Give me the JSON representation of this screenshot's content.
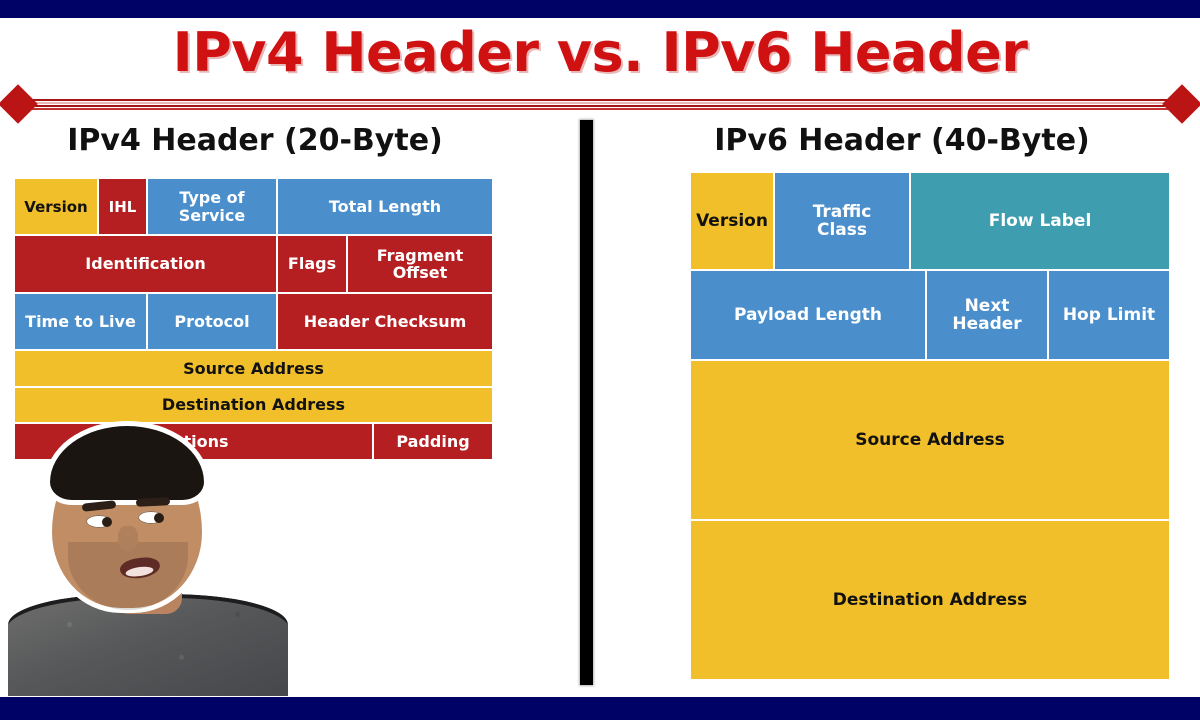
{
  "page": {
    "title": "IPv4 Header vs. IPv6 Header",
    "title_color": "#cf1111",
    "background": "#ffffff",
    "bar_color": "#000266",
    "divider_color": "#bb1414",
    "center_divider_color": "#000000"
  },
  "palette": {
    "yellow": "#f0bf2a",
    "blue": "#4a8fcb",
    "red": "#b61f22",
    "teal": "#3e9dae",
    "text_dark": "#121212",
    "text_light": "#ffffff"
  },
  "ipv4": {
    "heading": "IPv4 Header (20-Byte)",
    "rows": [
      {
        "cells": [
          {
            "label": "Version",
            "color": "yellow"
          },
          {
            "label": "IHL",
            "color": "red"
          },
          {
            "label": "Type of\nService",
            "color": "blue"
          },
          {
            "label": "Total Length",
            "color": "blue"
          }
        ]
      },
      {
        "cells": [
          {
            "label": "Identification",
            "color": "red"
          },
          {
            "label": "Flags",
            "color": "red"
          },
          {
            "label": "Fragment\nOffset",
            "color": "red"
          }
        ]
      },
      {
        "cells": [
          {
            "label": "Time to Live",
            "color": "blue"
          },
          {
            "label": "Protocol",
            "color": "blue"
          },
          {
            "label": "Header Checksum",
            "color": "red"
          }
        ]
      },
      {
        "cells": [
          {
            "label": "Source Address",
            "color": "yellow"
          }
        ]
      },
      {
        "cells": [
          {
            "label": "Destination Address",
            "color": "yellow"
          }
        ]
      },
      {
        "cells": [
          {
            "label": "Options",
            "color": "red"
          },
          {
            "label": "Padding",
            "color": "red"
          }
        ]
      }
    ]
  },
  "ipv6": {
    "heading": "IPv6 Header (40-Byte)",
    "rows": [
      {
        "cells": [
          {
            "label": "Version",
            "color": "yellow"
          },
          {
            "label": "Traffic\nClass",
            "color": "blue"
          },
          {
            "label": "Flow Label",
            "color": "teal"
          }
        ]
      },
      {
        "cells": [
          {
            "label": "Payload Length",
            "color": "blue"
          },
          {
            "label": "Next\nHeader",
            "color": "blue"
          },
          {
            "label": "Hop Limit",
            "color": "blue"
          }
        ]
      },
      {
        "cells": [
          {
            "label": "Source Address",
            "color": "yellow"
          }
        ]
      },
      {
        "cells": [
          {
            "label": "Destination Address",
            "color": "yellow"
          }
        ]
      }
    ]
  },
  "overlay": {
    "presenter": "presenter-webcam-cutout"
  }
}
